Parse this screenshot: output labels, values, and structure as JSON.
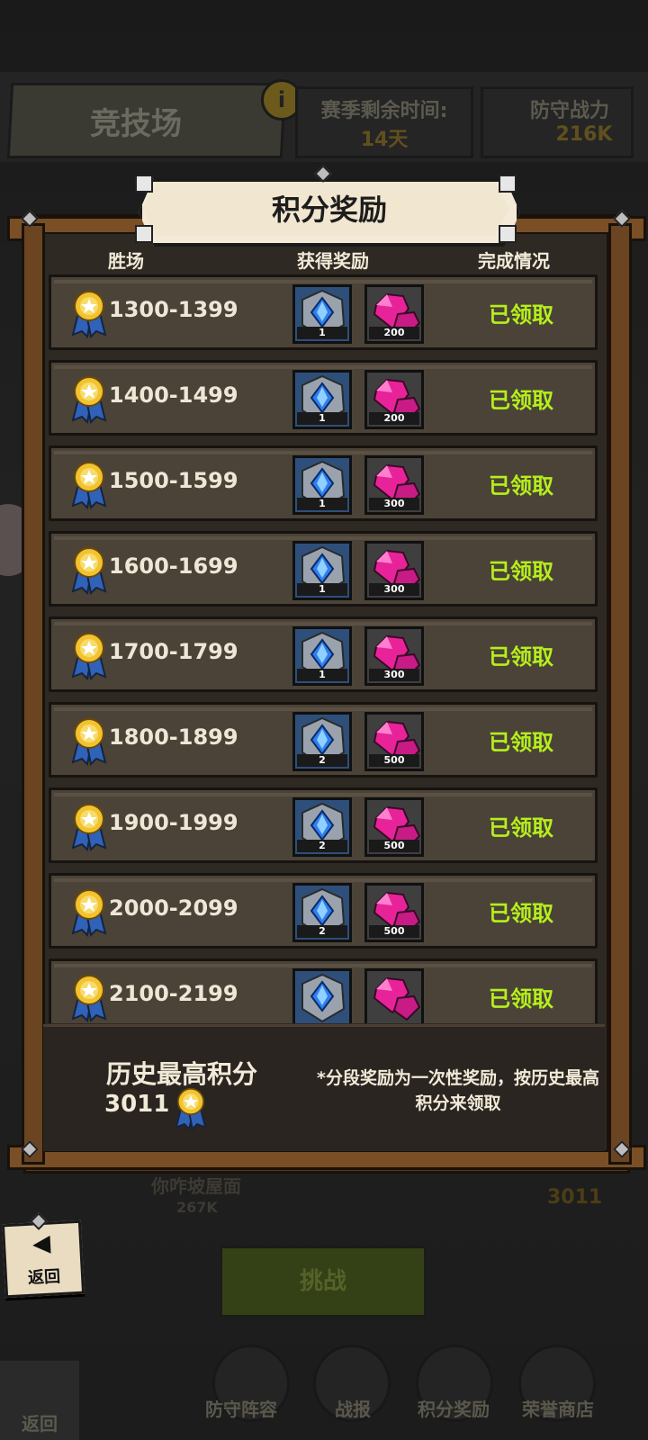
{
  "background": {
    "arena_title": "竞技场",
    "info_glyph": "i",
    "season_label": "赛季剩余时间:",
    "season_value": "14天",
    "defense_label": "防守战力",
    "defense_value": "216K",
    "opponent_name": "你咋坡屋面",
    "opponent_power": "267K",
    "opponent_score": "3011",
    "challenge_label": "挑战",
    "back_label": "返回",
    "tabs": [
      "防守阵容",
      "战报",
      "积分奖励",
      "荣誉商店"
    ]
  },
  "dialog": {
    "title": "积分奖励",
    "columns": [
      "胜场",
      "获得奖励",
      "完成情况"
    ],
    "back_button": {
      "icon": "back-arrow-icon",
      "glyph": "◀",
      "label": "返回"
    },
    "rewards": [
      {
        "range": "1300-1399",
        "stone_qty": "1",
        "gem_qty": "200",
        "status": "已领取"
      },
      {
        "range": "1400-1499",
        "stone_qty": "1",
        "gem_qty": "200",
        "status": "已领取"
      },
      {
        "range": "1500-1599",
        "stone_qty": "1",
        "gem_qty": "300",
        "status": "已领取"
      },
      {
        "range": "1600-1699",
        "stone_qty": "1",
        "gem_qty": "300",
        "status": "已领取"
      },
      {
        "range": "1700-1799",
        "stone_qty": "1",
        "gem_qty": "300",
        "status": "已领取"
      },
      {
        "range": "1800-1899",
        "stone_qty": "2",
        "gem_qty": "500",
        "status": "已领取"
      },
      {
        "range": "1900-1999",
        "stone_qty": "2",
        "gem_qty": "500",
        "status": "已领取"
      },
      {
        "range": "2000-2099",
        "stone_qty": "2",
        "gem_qty": "500",
        "status": "已领取"
      },
      {
        "range": "2100-2199",
        "stone_qty": "",
        "gem_qty": "",
        "status": "已领取"
      }
    ],
    "highest_score_label": "历史最高积分",
    "highest_score_value": "3011",
    "note": "*分段奖励为一次性奖励，按历史最高积分来领取",
    "colors": {
      "claimed": "#b5ef1c",
      "gem": "#e8239a",
      "stone_bg": "#2e4f7a",
      "medal": "#f2c230",
      "ribbon": "#2f62b8"
    }
  }
}
